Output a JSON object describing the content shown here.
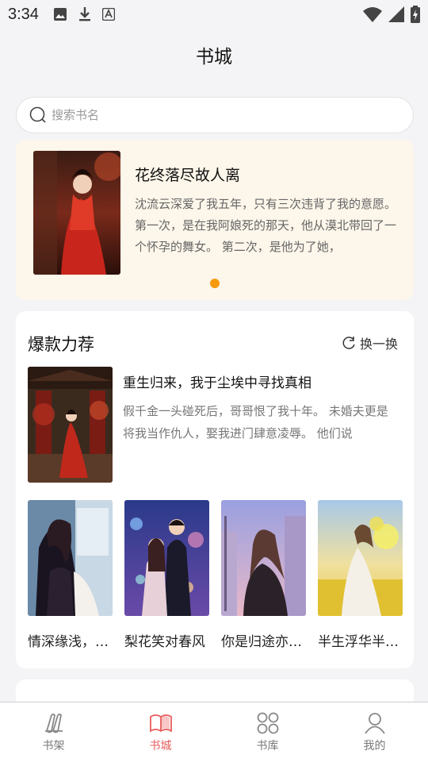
{
  "status_bar": {
    "time": "3:34",
    "left_icons": [
      "image-icon",
      "download-icon",
      "font-icon"
    ],
    "right_icons": [
      "wifi-icon",
      "signal-icon",
      "battery-charging-icon"
    ]
  },
  "header": {
    "title": "书城"
  },
  "search": {
    "placeholder": "搜索书名"
  },
  "banner": {
    "title": "花终落尽故人离",
    "description": "沈流云深爱了我五年，只有三次违背了我的意愿。 第一次，是在我阿娘死的那天，他从漠北带回了一个怀孕的舞女。 第二次，是他为了她，",
    "active_dot_color": "#f59a0c"
  },
  "recommend": {
    "title": "爆款力荐",
    "refresh_label": "换一换",
    "featured": {
      "title": "重生归来，我于尘埃中寻找真相",
      "description": "假千金一头碰死后，哥哥恨了我十年。 未婚夫更是将我当作仇人，娶我进门肆意凌辱。 他们说"
    },
    "books": [
      {
        "title": "情深缘浅，故人难留"
      },
      {
        "title": "梨花笑对春风"
      },
      {
        "title": "你是归途亦是远方"
      },
      {
        "title": "半生浮华半生缘"
      }
    ]
  },
  "tabs": [
    {
      "label": "书架",
      "icon": "bookshelf-icon",
      "active": false
    },
    {
      "label": "书城",
      "icon": "bookstore-icon",
      "active": true
    },
    {
      "label": "书库",
      "icon": "library-grid-icon",
      "active": false
    },
    {
      "label": "我的",
      "icon": "profile-icon",
      "active": false
    }
  ],
  "colors": {
    "accent": "#e95c5c",
    "banner_bg": "#fdf6ea",
    "page_bg": "#f4f4f6"
  }
}
